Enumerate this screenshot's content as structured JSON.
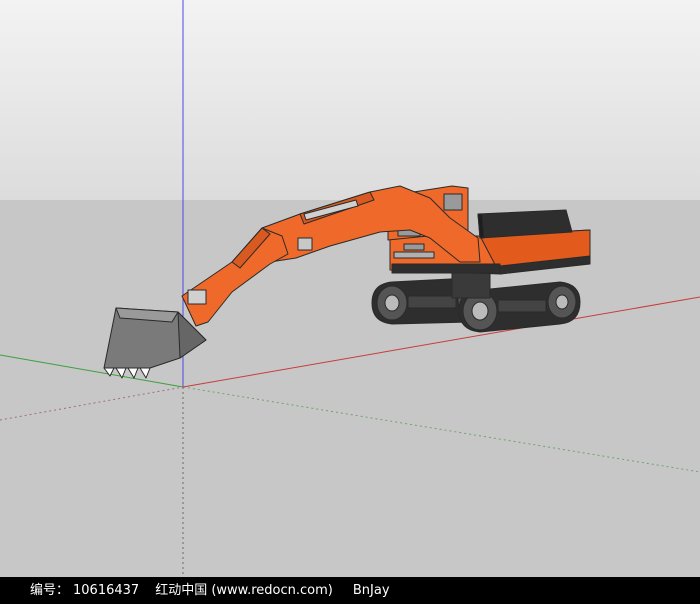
{
  "scene": {
    "sky_color": "#dcdcdc",
    "ground_color": "#c7c7c7",
    "axis_colors": {
      "blue": "#4a4ae6",
      "green": "#3ca03c",
      "red": "#c83c3c"
    },
    "model": {
      "body_color": "#ef6a2a",
      "dark_color": "#2e2e2e",
      "bucket_color": "#7a7a7a"
    }
  },
  "footer": {
    "id_label": "编号：",
    "id_value": "10616437",
    "site": "红动中国 (www.redocn.com)",
    "author": "BnJay"
  }
}
